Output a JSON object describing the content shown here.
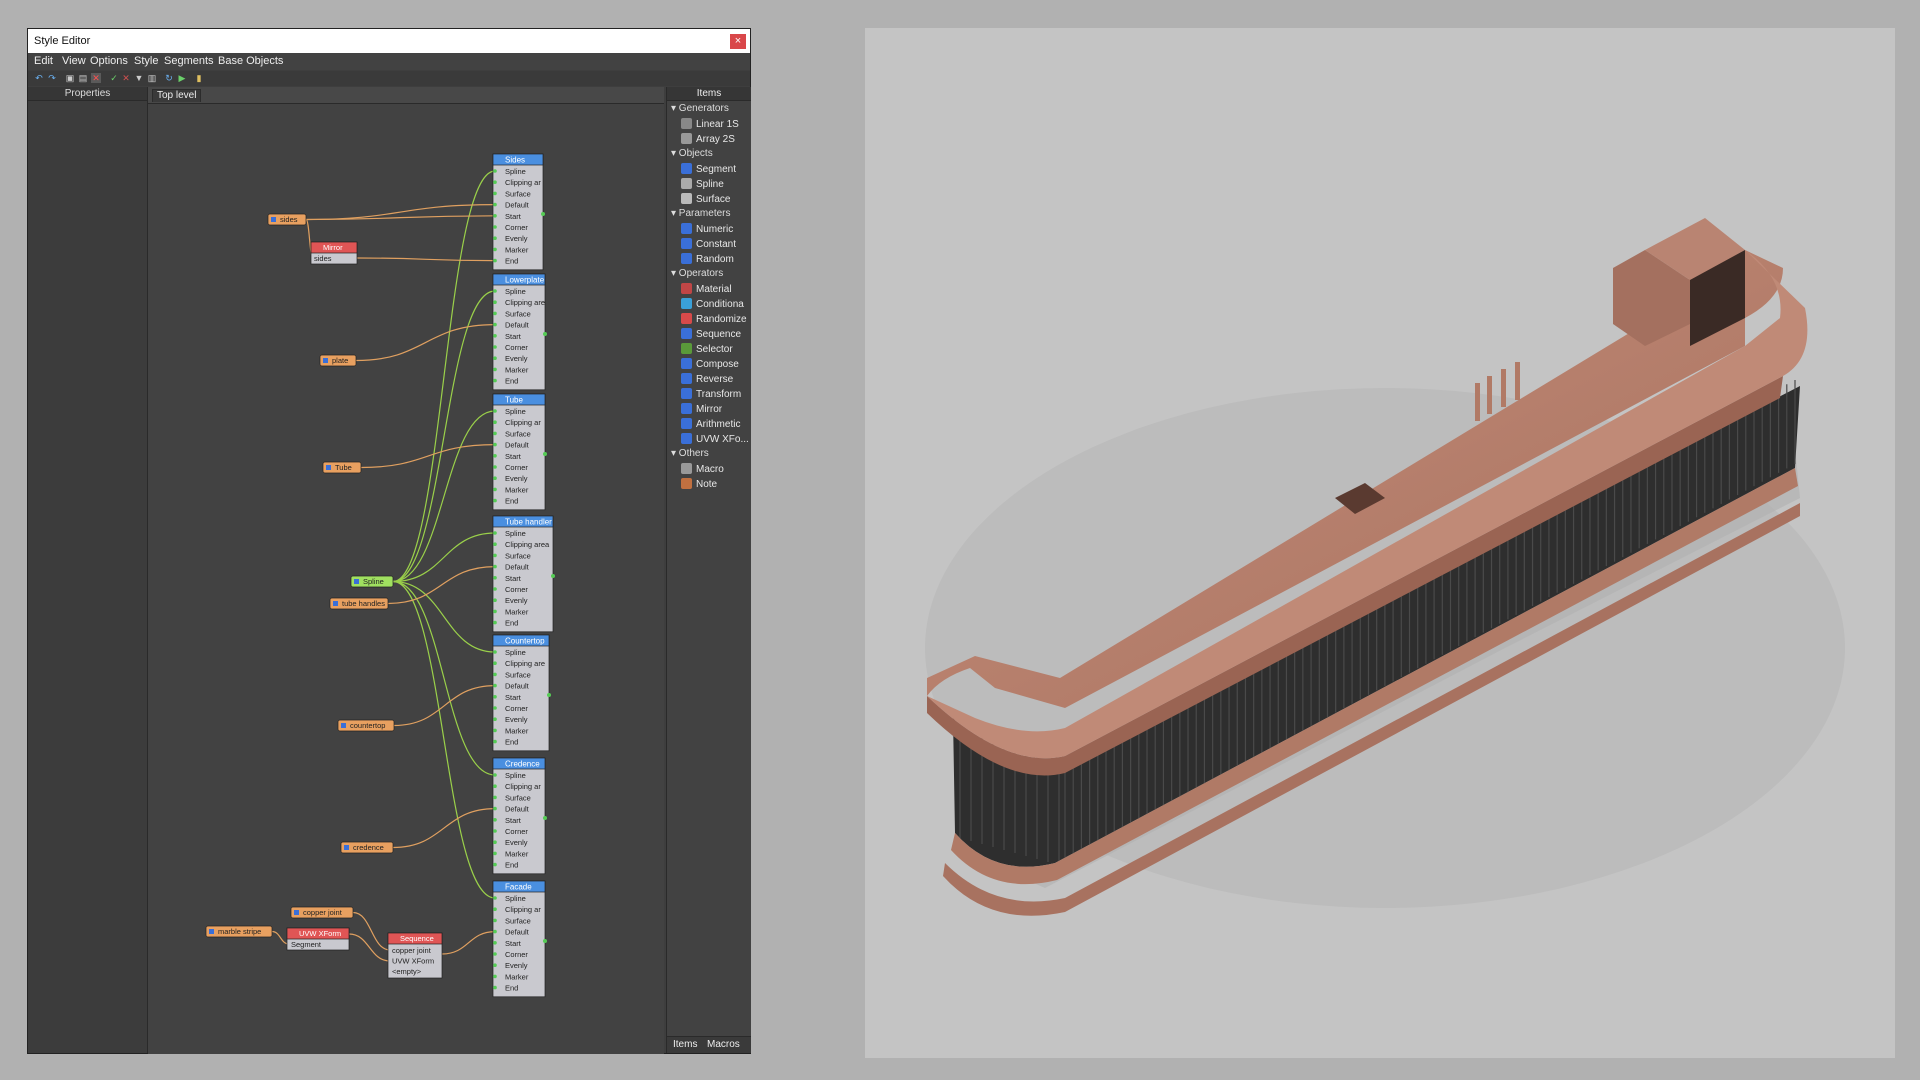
{
  "window": {
    "title": "Style Editor",
    "close_glyph": "×"
  },
  "menu": [
    "Edit",
    "View",
    "Options",
    "Style",
    "Segments",
    "Base Objects"
  ],
  "panels": {
    "properties": "Properties",
    "canvas_tab": "Top level",
    "items": "Items"
  },
  "items_panel": {
    "categories": [
      {
        "name": "Generators",
        "items": [
          {
            "label": "Linear 1S",
            "icon": "linear-icon",
            "color": "#888"
          },
          {
            "label": "Array 2S",
            "icon": "array-icon",
            "color": "#999"
          }
        ]
      },
      {
        "name": "Objects",
        "items": [
          {
            "label": "Segment",
            "icon": "segment-icon",
            "color": "#3a6fd8"
          },
          {
            "label": "Spline",
            "icon": "spline-icon",
            "color": "#aaa"
          },
          {
            "label": "Surface",
            "icon": "surface-icon",
            "color": "#bbb"
          }
        ]
      },
      {
        "name": "Parameters",
        "items": [
          {
            "label": "Numeric",
            "icon": "numeric-icon",
            "color": "#3a6fd8"
          },
          {
            "label": "Constant",
            "icon": "constant-icon",
            "color": "#3a6fd8"
          },
          {
            "label": "Random",
            "icon": "random-icon",
            "color": "#3a6fd8"
          }
        ]
      },
      {
        "name": "Operators",
        "items": [
          {
            "label": "Material",
            "icon": "material-icon",
            "color": "#c04646"
          },
          {
            "label": "Conditiona",
            "icon": "conditional-icon",
            "color": "#3aa0d8"
          },
          {
            "label": "Randomize",
            "icon": "randomize-icon",
            "color": "#d84a4a"
          },
          {
            "label": "Sequence",
            "icon": "sequence-icon",
            "color": "#3a6fd8"
          },
          {
            "label": "Selector",
            "icon": "selector-icon",
            "color": "#5a9a3a"
          },
          {
            "label": "Compose",
            "icon": "compose-icon",
            "color": "#3a6fd8"
          },
          {
            "label": "Reverse",
            "icon": "reverse-icon",
            "color": "#3a6fd8"
          },
          {
            "label": "Transform",
            "icon": "transform-icon",
            "color": "#3a6fd8"
          },
          {
            "label": "Mirror",
            "icon": "mirror-icon",
            "color": "#3a6fd8"
          },
          {
            "label": "Arithmetic",
            "icon": "arithmetic-icon",
            "color": "#3a6fd8"
          },
          {
            "label": "UVW XFo...",
            "icon": "uvw-icon",
            "color": "#3a6fd8"
          }
        ]
      },
      {
        "name": "Others",
        "items": [
          {
            "label": "Macro",
            "icon": "macro-icon",
            "color": "#999"
          },
          {
            "label": "Note",
            "icon": "note-icon",
            "color": "#c07040"
          }
        ]
      }
    ],
    "tabs": [
      "Items",
      "Macros"
    ]
  },
  "segment_ports": [
    "Spline",
    "Clipping area",
    "Surface",
    "Default",
    "Start",
    "Corner",
    "Evenly",
    "Marker",
    "End"
  ],
  "segments": [
    {
      "title": "Sides",
      "ports": [
        "Spline",
        "Clipping ar",
        "Surface",
        "Default",
        "Start",
        "Corner",
        "Evenly",
        "Marker",
        "End"
      ]
    },
    {
      "title": "Lowerplate",
      "ports": [
        "Spline",
        "Clipping are",
        "Surface",
        "Default",
        "Start",
        "Corner",
        "Evenly",
        "Marker",
        "End"
      ]
    },
    {
      "title": "Tube",
      "ports": [
        "Spline",
        "Clipping ar",
        "Surface",
        "Default",
        "Start",
        "Corner",
        "Evenly",
        "Marker",
        "End"
      ]
    },
    {
      "title": "Tube handler",
      "ports": [
        "Spline",
        "Clipping area",
        "Surface",
        "Default",
        "Start",
        "Corner",
        "Evenly",
        "Marker",
        "End"
      ]
    },
    {
      "title": "Countertop",
      "ports": [
        "Spline",
        "Clipping are",
        "Surface",
        "Default",
        "Start",
        "Corner",
        "Evenly",
        "Marker",
        "End"
      ]
    },
    {
      "title": "Credence",
      "ports": [
        "Spline",
        "Clipping ar",
        "Surface",
        "Default",
        "Start",
        "Corner",
        "Evenly",
        "Marker",
        "End"
      ]
    },
    {
      "title": "Facade",
      "ports": [
        "Spline",
        "Clipping ar",
        "Surface",
        "Default",
        "Start",
        "Corner",
        "Evenly",
        "Marker",
        "End"
      ]
    }
  ],
  "materials": [
    "sides",
    "plate",
    "Tube",
    "tube handles",
    "countertop",
    "credence",
    "copper joint",
    "marble stripe"
  ],
  "mirror_node": {
    "title": "Mirror",
    "port": "sides"
  },
  "spline_node": "Spline",
  "uvw_node": {
    "title": "UVW XForm",
    "port": "Segment"
  },
  "sequence_node": {
    "title": "Sequence",
    "ports": [
      "copper joint",
      "UVW XForm",
      "<empty>"
    ]
  },
  "colors": {
    "segment_header": "#4a8fe0",
    "material_node": "#e8a060",
    "operator_header": "#e05555",
    "spline_node": "#a0e060",
    "wire_green": "#9ad04a",
    "wire_orange": "#e0a060"
  }
}
